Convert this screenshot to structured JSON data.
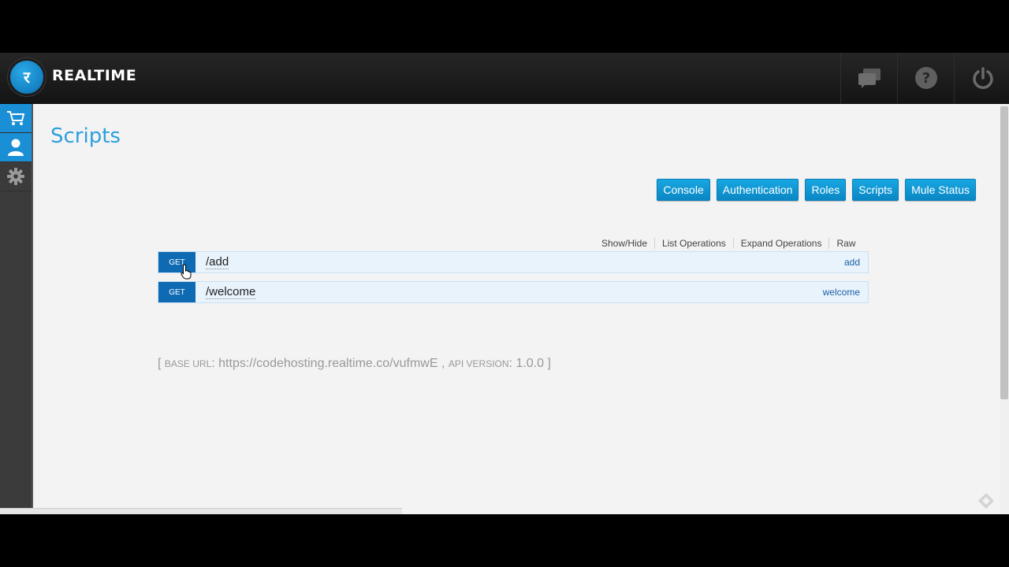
{
  "header": {
    "logo_glyph": "र",
    "brand": "REALTIME",
    "icons": [
      "chat-icon",
      "help-icon",
      "power-icon"
    ]
  },
  "sidebar": {
    "items": [
      {
        "icon": "cart-icon",
        "active": false
      },
      {
        "icon": "user-icon",
        "active": true
      },
      {
        "icon": "gear-icon",
        "active": false
      }
    ]
  },
  "main": {
    "title": "Scripts",
    "buttons": [
      "Console",
      "Authentication",
      "Roles",
      "Scripts",
      "Mule Status"
    ],
    "ops_links": [
      "Show/Hide",
      "List Operations",
      "Expand Operations",
      "Raw"
    ],
    "endpoints": [
      {
        "method": "GET",
        "path": "/add",
        "name": "add"
      },
      {
        "method": "GET",
        "path": "/welcome",
        "name": "welcome"
      }
    ],
    "base": {
      "open": "[",
      "base_label": "BASE URL",
      "base_url": "https://codehosting.realtime.co/vufmwE",
      "api_label": "API VERSION",
      "api_version": "1.0.0",
      "close": "]"
    }
  },
  "colors": {
    "accent": "#1a8fd6",
    "title": "#2d9fdc",
    "method": "#0f6ab4"
  }
}
